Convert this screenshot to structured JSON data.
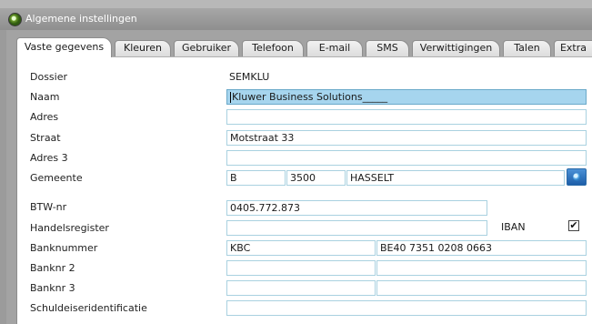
{
  "window": {
    "title": "Algemene instellingen"
  },
  "tabs": [
    {
      "label": "Vaste gegevens",
      "active": true
    },
    {
      "label": "Kleuren"
    },
    {
      "label": "Gebruiker"
    },
    {
      "label": "Telefoon"
    },
    {
      "label": "E-mail"
    },
    {
      "label": "SMS"
    },
    {
      "label": "Verwittigingen"
    },
    {
      "label": "Talen"
    },
    {
      "label": "Extra"
    }
  ],
  "form": {
    "dossier": {
      "label": "Dossier",
      "value": "SEMKLU"
    },
    "naam": {
      "label": "Naam",
      "value": "Kluwer Business Solutions_____"
    },
    "adres": {
      "label": "Adres",
      "value": ""
    },
    "straat": {
      "label": "Straat",
      "value": "Motstraat 33"
    },
    "adres3": {
      "label": "Adres 3",
      "value": ""
    },
    "gemeente": {
      "label": "Gemeente",
      "country": "B",
      "postcode": "3500",
      "city": "HASSELT",
      "lookup_icon": "globe-icon"
    },
    "btw": {
      "label": "BTW-nr",
      "value": "0405.772.873"
    },
    "handelsregister": {
      "label": "Handelsregister",
      "value": ""
    },
    "iban": {
      "label": "IBAN",
      "checked": true,
      "check_glyph": "✔"
    },
    "banknummer": {
      "label": "Banknummer",
      "bank": "KBC",
      "account": "BE40 7351 0208 0663"
    },
    "banknr2": {
      "label": "Banknr 2",
      "bank": "",
      "account": ""
    },
    "banknr3": {
      "label": "Banknr 3",
      "bank": "",
      "account": ""
    },
    "schuldeiser": {
      "label": "Schuldeiseridentificatie",
      "value": ""
    }
  },
  "colors": {
    "field_border": "#a9d1e0",
    "selection": "#a6d5ee",
    "panel": "#a3a3a3"
  }
}
